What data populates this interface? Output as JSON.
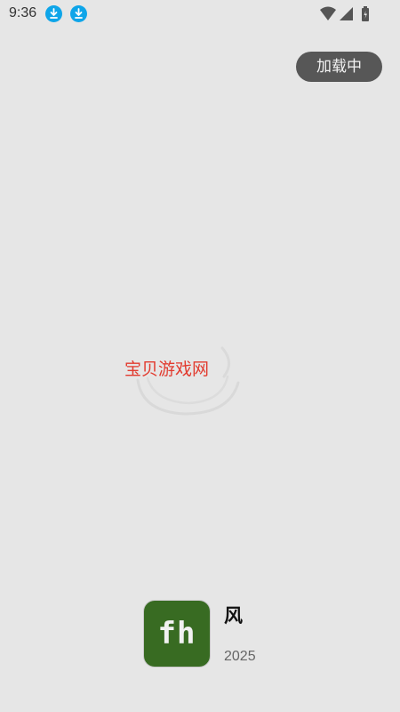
{
  "status_bar": {
    "time": "9:36",
    "notifications": [
      "download-icon",
      "download-icon"
    ],
    "system_icons": [
      "wifi-icon",
      "signal-icon",
      "battery-charging-icon"
    ]
  },
  "loading_badge": {
    "label": "加载中"
  },
  "splash": {
    "logo_text": "宝贝游戏网",
    "logo_color": "#e23b2f"
  },
  "app": {
    "icon_text": "fh",
    "icon_bg": "#386b22",
    "title": "风",
    "date": "2025"
  }
}
